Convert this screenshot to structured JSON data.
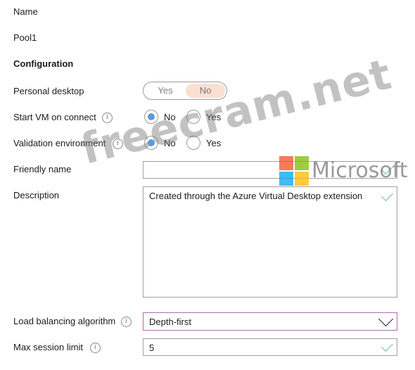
{
  "name_label": "Name",
  "name_value": "Pool1",
  "section_title": "Configuration",
  "personal_desktop": {
    "label": "Personal desktop",
    "options": [
      "Yes",
      "No"
    ],
    "selected": "No"
  },
  "start_vm": {
    "label": "Start VM on connect",
    "options": [
      "No",
      "Yes"
    ],
    "selected": "No"
  },
  "validation_env": {
    "label": "Validation environment",
    "options": [
      "No",
      "Yes"
    ],
    "selected": "No"
  },
  "friendly_name": {
    "label": "Friendly name",
    "value": ""
  },
  "description": {
    "label": "Description",
    "value": "Created through the Azure Virtual Desktop extension"
  },
  "load_balancing": {
    "label": "Load balancing algorithm",
    "value": "Depth-first"
  },
  "max_session": {
    "label": "Max session limit",
    "value": "5"
  },
  "info_glyph": "i",
  "watermark": {
    "text": "freecram.net",
    "brand": "Microsoft",
    "logo_colors": [
      "#f25022",
      "#7fba00",
      "#00a4ef",
      "#ffb900"
    ]
  },
  "colors": {
    "radio_selected": "#5b9bd5",
    "toggle_selected_bg": "#fadfd2",
    "check": "#77c38a",
    "dropdown_border": "#b469b0"
  }
}
